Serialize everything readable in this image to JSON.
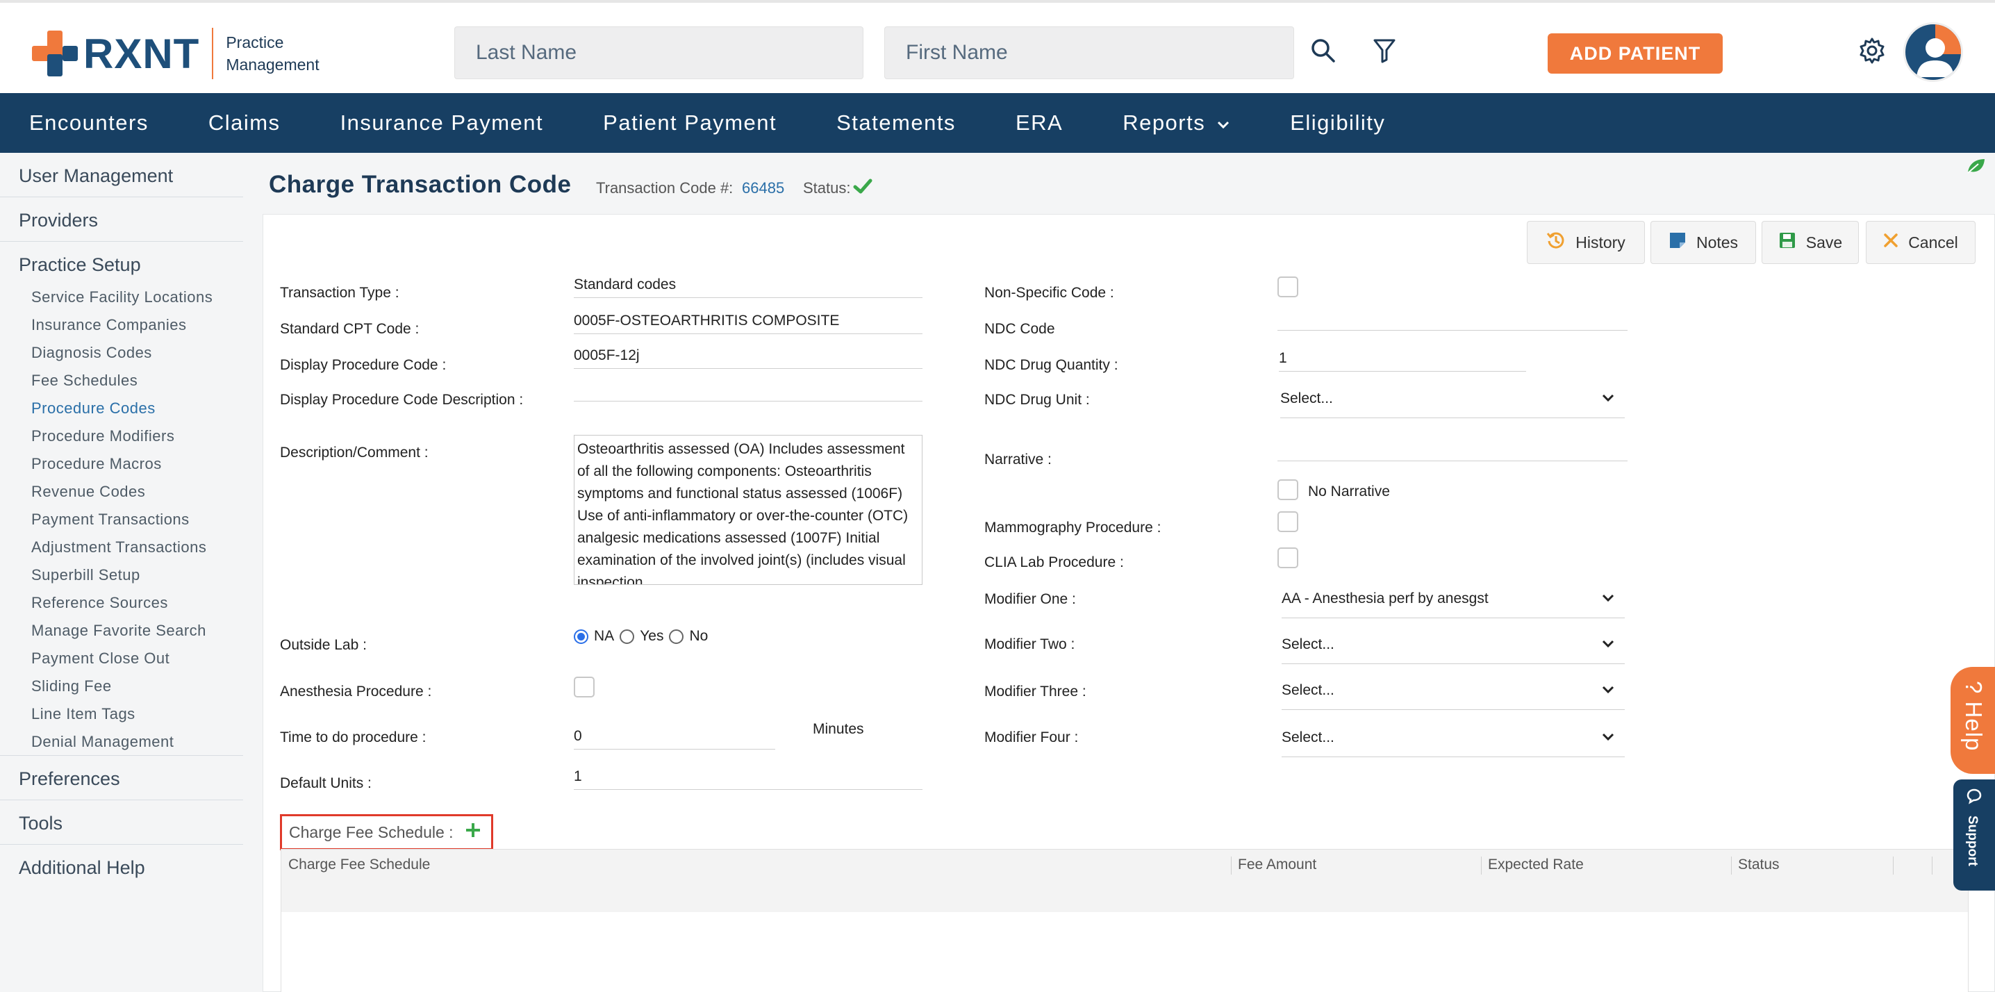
{
  "header": {
    "brand": "RXNT",
    "product_line1": "Practice",
    "product_line2": "Management",
    "last_name_placeholder": "Last Name",
    "first_name_placeholder": "First Name",
    "add_patient": "ADD PATIENT"
  },
  "nav": {
    "items": [
      "Encounters",
      "Claims",
      "Insurance Payment",
      "Patient Payment",
      "Statements",
      "ERA",
      "Reports",
      "Eligibility"
    ]
  },
  "sidebar": {
    "user_management": "User Management",
    "providers": "Providers",
    "practice_setup": "Practice Setup",
    "sub_items": [
      "Service Facility Locations",
      "Insurance Companies",
      "Diagnosis Codes",
      "Fee Schedules",
      "Procedure Codes",
      "Procedure Modifiers",
      "Procedure Macros",
      "Revenue Codes",
      "Payment Transactions",
      "Adjustment Transactions",
      "Superbill Setup",
      "Reference Sources",
      "Manage Favorite Search",
      "Payment Close Out",
      "Sliding Fee",
      "Line Item Tags",
      "Denial Management"
    ],
    "preferences": "Preferences",
    "tools": "Tools",
    "additional_help": "Additional Help"
  },
  "page": {
    "title": "Charge Transaction Code",
    "transaction_code_label": "Transaction Code #:",
    "transaction_code": "66485",
    "status_label": "Status:"
  },
  "toolbar": {
    "history": "History",
    "notes": "Notes",
    "save": "Save",
    "cancel": "Cancel"
  },
  "form": {
    "transaction_type_label": "Transaction Type :",
    "transaction_type": "Standard codes",
    "standard_cpt_label": "Standard CPT Code :",
    "standard_cpt": "0005F-OSTEOARTHRITIS COMPOSITE",
    "display_proc_code_label": "Display Procedure Code :",
    "display_proc_code": "0005F-12j",
    "display_proc_desc_label": "Display Procedure Code Description :",
    "display_proc_desc": "",
    "description_label": "Description/Comment :",
    "description": "Osteoarthritis assessed (OA) Includes assessment of all the following components: Osteoarthritis symptoms and functional status assessed (1006F) Use of anti-inflammatory or over-the-counter (OTC) analgesic medications assessed (1007F) Initial examination of the involved joint(s) (includes visual inspection",
    "outside_lab_label": "Outside Lab :",
    "outside_lab_options": [
      "NA",
      "Yes",
      "No"
    ],
    "anesthesia_label": "Anesthesia Procedure :",
    "time_label": "Time to do procedure :",
    "time_value": "0",
    "minutes": "Minutes",
    "default_units_label": "Default Units :",
    "default_units": "1",
    "non_specific_label": "Non-Specific Code :",
    "ndc_code_label": "NDC Code",
    "ndc_code": "",
    "ndc_qty_label": "NDC Drug Quantity :",
    "ndc_qty": "1",
    "ndc_unit_label": "NDC Drug Unit :",
    "ndc_unit": "Select...",
    "narrative_label": "Narrative :",
    "narrative": "",
    "no_narrative": "No Narrative",
    "mammography_label": "Mammography Procedure :",
    "clia_label": "CLIA Lab Procedure :",
    "modifier_one_label": "Modifier One :",
    "modifier_one": "AA - Anesthesia perf by anesgst",
    "modifier_two_label": "Modifier Two :",
    "modifier_two": "Select...",
    "modifier_three_label": "Modifier Three :",
    "modifier_three": "Select...",
    "modifier_four_label": "Modifier Four :",
    "modifier_four": "Select..."
  },
  "fee_schedule": {
    "label": "Charge Fee Schedule :",
    "columns": [
      "Charge Fee Schedule",
      "Fee Amount",
      "Expected Rate",
      "Status"
    ]
  },
  "side_tabs": {
    "help": "? Help",
    "support": "Support"
  },
  "colors": {
    "brand_orange": "#f0793c",
    "brand_navy": "#173f63",
    "link_blue": "#2a6fa8",
    "status_green": "#3aa84a",
    "highlight_red": "#e03a2a"
  }
}
